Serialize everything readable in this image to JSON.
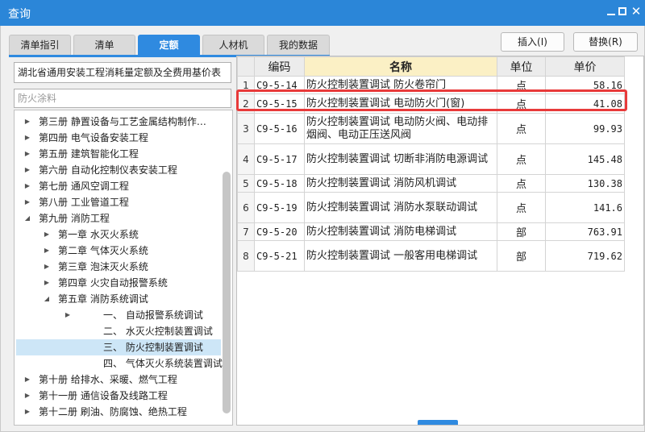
{
  "window": {
    "title": "查询",
    "close_glyph": "✕"
  },
  "tabs": [
    {
      "label": "清单指引",
      "active": false
    },
    {
      "label": "清单",
      "active": false
    },
    {
      "label": "定额",
      "active": true
    },
    {
      "label": "人材机",
      "active": false
    },
    {
      "label": "我的数据",
      "active": false
    }
  ],
  "actions": {
    "insert": "插入(I)",
    "replace": "替换(R)"
  },
  "left": {
    "library_select": "湖北省通用安装工程消耗量定额及全费用基价表",
    "search_placeholder": "防火涂料",
    "tree": [
      {
        "label": "第三册  静置设备与工艺金属结构制作…",
        "level": 0,
        "expanded": false,
        "selected": false
      },
      {
        "label": "第四册  电气设备安装工程",
        "level": 0,
        "expanded": false,
        "selected": false
      },
      {
        "label": "第五册  建筑智能化工程",
        "level": 0,
        "expanded": false,
        "selected": false
      },
      {
        "label": "第六册  自动化控制仪表安装工程",
        "level": 0,
        "expanded": false,
        "selected": false
      },
      {
        "label": "第七册  通风空调工程",
        "level": 0,
        "expanded": false,
        "selected": false
      },
      {
        "label": "第八册  工业管道工程",
        "level": 0,
        "expanded": false,
        "selected": false
      },
      {
        "label": "第九册  消防工程",
        "level": 0,
        "expanded": true,
        "selected": false
      },
      {
        "label": "第一章  水灭火系统",
        "level": 1,
        "expanded": false,
        "selected": false
      },
      {
        "label": "第二章  气体灭火系统",
        "level": 1,
        "expanded": false,
        "selected": false
      },
      {
        "label": "第三章  泡沫灭火系统",
        "level": 1,
        "expanded": false,
        "selected": false
      },
      {
        "label": "第四章  火灾自动报警系统",
        "level": 1,
        "expanded": false,
        "selected": false
      },
      {
        "label": "第五章  消防系统调试",
        "level": 1,
        "expanded": true,
        "selected": false
      },
      {
        "label": "一、  自动报警系统调试",
        "level": 2,
        "expanded": false,
        "selected": false
      },
      {
        "label": "二、  水灭火控制装置调试",
        "level": 2,
        "expanded": null,
        "selected": false
      },
      {
        "label": "三、  防火控制装置调试",
        "level": 2,
        "expanded": null,
        "selected": true
      },
      {
        "label": "四、  气体灭火系统装置调试",
        "level": 2,
        "expanded": null,
        "selected": false
      },
      {
        "label": "第十册  给排水、采暖、燃气工程",
        "level": 0,
        "expanded": false,
        "selected": false
      },
      {
        "label": "第十一册  通信设备及线路工程",
        "level": 0,
        "expanded": false,
        "selected": false
      },
      {
        "label": "第十二册  刷油、防腐蚀、绝热工程",
        "level": 0,
        "expanded": false,
        "selected": false
      }
    ]
  },
  "table": {
    "headers": {
      "code": "编码",
      "name": "名称",
      "unit": "单位",
      "price": "单价"
    },
    "rows": [
      {
        "idx": "1",
        "code": "C9-5-14",
        "name": "防火控制装置调试 防火卷帘门",
        "unit": "点",
        "price": "58.16"
      },
      {
        "idx": "2",
        "code": "C9-5-15",
        "name": "防火控制装置调试 电动防火门(窗)",
        "unit": "点",
        "price": "41.08"
      },
      {
        "idx": "3",
        "code": "C9-5-16",
        "name": "防火控制装置调试 电动防火阀、电动排烟阀、电动正压送风阀",
        "unit": "点",
        "price": "99.93"
      },
      {
        "idx": "4",
        "code": "C9-5-17",
        "name": "防火控制装置调试 切断非消防电源调试",
        "unit": "点",
        "price": "145.48"
      },
      {
        "idx": "5",
        "code": "C9-5-18",
        "name": "防火控制装置调试 消防风机调试",
        "unit": "点",
        "price": "130.38"
      },
      {
        "idx": "6",
        "code": "C9-5-19",
        "name": "防火控制装置调试 消防水泵联动调试",
        "unit": "点",
        "price": "141.6"
      },
      {
        "idx": "7",
        "code": "C9-5-20",
        "name": "防火控制装置调试 消防电梯调试",
        "unit": "部",
        "price": "763.91"
      },
      {
        "idx": "8",
        "code": "C9-5-21",
        "name": "防火控制装置调试 一般客用电梯调试",
        "unit": "部",
        "price": "719.62"
      }
    ]
  },
  "colors": {
    "titlebar": "#2b86d8",
    "tab_active": "#2f8ae0",
    "name_header": "#fbf0c5",
    "highlight": "#e83a3a",
    "selected_node": "#cde6f7"
  }
}
